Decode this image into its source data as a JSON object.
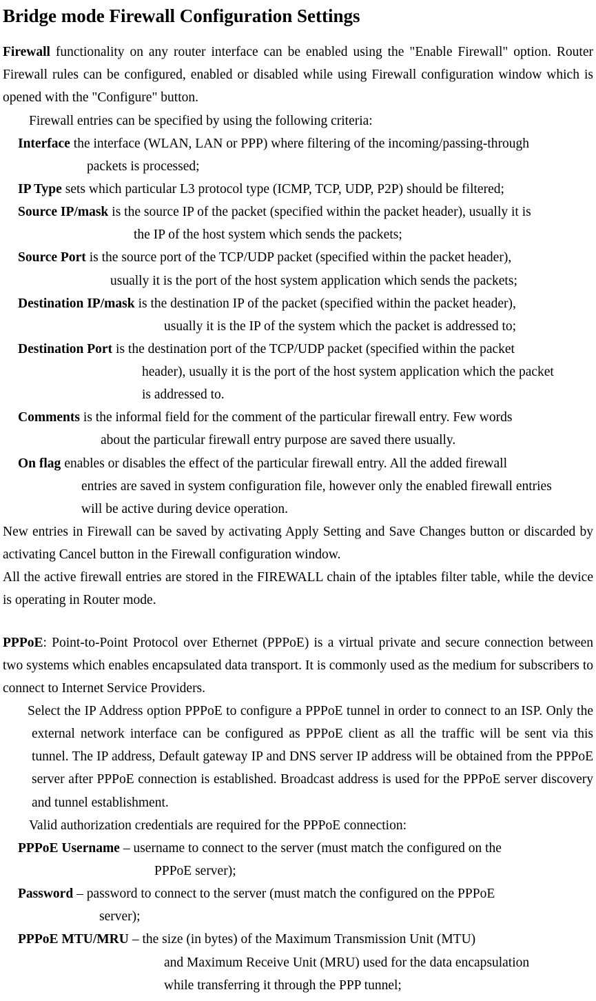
{
  "title": "Bridge mode Firewall Configuration Settings",
  "firewall_intro": {
    "strong": "Firewall",
    "text1": " functionality on any router interface can be enabled using the \"Enable Firewall\" option. Router Firewall rules can be configured, enabled or disabled while using Firewall configuration window which is opened with the \"Configure\" button.",
    "text2": "Firewall entries can be specified by using the following criteria:"
  },
  "firewall_defs": {
    "interface": {
      "term": "Interface",
      "def1": " the interface (WLAN, LAN or PPP) where filtering of the incoming/passing-through",
      "def2": "packets is processed;",
      "pad": "100px"
    },
    "iptype": {
      "term": "IP Type",
      "def1": " sets which particular L3 protocol type (ICMP, TCP, UDP, P2P) should be filtered;"
    },
    "srcip": {
      "term": "Source IP/mask",
      "def1": " is the source IP of the packet (specified within the packet header), usually it is",
      "def2": "the IP of the host system which sends the packets;",
      "pad": "168px"
    },
    "srcport": {
      "term": "Source Port",
      "def1": " is the source port of the TCP/UDP packet (specified within the packet header),",
      "def2": "usually it is the port of the host system application which sends the packets;",
      "pad": "134px"
    },
    "dstip": {
      "term": "Destination IP/mask",
      "def1": " is the destination IP of the packet (specified within the packet header),",
      "def2": "usually it is the IP of the system which the packet is addressed to;",
      "pad": "212px"
    },
    "dstport": {
      "term": "Destination Port",
      "def1": " is the destination port of the TCP/UDP packet (specified within the packet",
      "def2": "header), usually it is the port of the host system application which the packet",
      "def3": "is addressed to.",
      "pad": "180px"
    },
    "comments": {
      "term": "Comments",
      "def1": " is the informal field for the comment of the particular firewall entry. Few words",
      "def2": "about the particular firewall entry purpose are saved there usually.",
      "pad": "120px"
    },
    "onflag": {
      "term": "On flag",
      "def1": " enables or disables the effect of the particular firewall entry. All the added firewall",
      "def2": "entries are saved in system configuration file, however only the enabled firewall entries",
      "def3": "will be active during device operation.",
      "pad": "92px"
    }
  },
  "firewall_after": {
    "text1": "New entries in Firewall can be saved by activating Apply Setting and Save Changes button or discarded by activating Cancel button in the Firewall configuration window.",
    "text2": "All the active firewall entries are stored in the FIREWALL chain of the iptables filter table, while the device is operating in Router mode."
  },
  "pppoe": {
    "strong": "PPPoE",
    "text1": ": Point-to-Point Protocol over Ethernet (PPPoE) is a virtual private and secure connection between two systems which enables encapsulated data transport. It is commonly used as the medium for subscribers to connect to Internet Service Providers.",
    "text2": "Select the IP Address option PPPoE to configure a PPPoE tunnel in order to connect to an ISP. Only the external network interface can be configured as PPPoE client as all the traffic will be sent via this tunnel. The IP address, Default gateway IP and DNS server IP address will be obtained from the PPPoE server after PPPoE connection is established. Broadcast address is used for the PPPoE server discovery and tunnel establishment.",
    "text3": "Valid authorization credentials are required for the PPPoE connection:"
  },
  "pppoe_defs": {
    "username": {
      "term": "PPPoE Username",
      "def1": " – username to connect to the server (must match the configured on the",
      "def2": "PPPoE server);",
      "pad": "198px"
    },
    "password": {
      "term": "Password",
      "def1": " – password to connect to the server (must match the configured on the PPPoE",
      "def2": "server);",
      "pad": "118px"
    },
    "mtu": {
      "term": "PPPoE MTU/MRU",
      "def1": " – the size (in bytes) of the Maximum Transmission Unit (MTU)",
      "def2": "and Maximum Receive Unit (MRU) used for the data encapsulation",
      "def3": "while transferring it through the PPP tunnel;",
      "pad": "212px"
    }
  }
}
